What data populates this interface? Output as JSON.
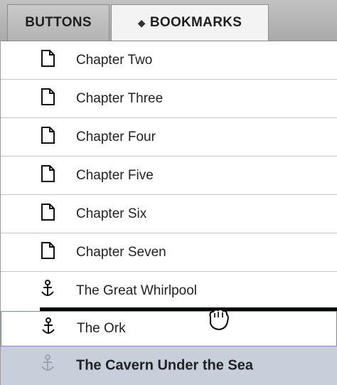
{
  "tabs": [
    {
      "label": "BUTTONS",
      "active": false
    },
    {
      "label": "BOOKMARKS",
      "active": true,
      "sort_glyph": "♢"
    }
  ],
  "bookmarks": [
    {
      "label": "Chapter Two",
      "icon": "page-icon"
    },
    {
      "label": "Chapter Three",
      "icon": "page-icon"
    },
    {
      "label": "Chapter Four",
      "icon": "page-icon"
    },
    {
      "label": "Chapter Five",
      "icon": "page-icon"
    },
    {
      "label": "Chapter Six",
      "icon": "page-icon"
    },
    {
      "label": "Chapter Seven",
      "icon": "page-icon"
    },
    {
      "label": "The Great Whirlpool",
      "icon": "anchor-icon"
    },
    {
      "label": "The Ork",
      "icon": "anchor-icon",
      "state": "drop-target"
    },
    {
      "label": "The Cavern Under the Sea",
      "icon": "anchor-icon",
      "state": "selected"
    }
  ],
  "colors": {
    "selected_row": "#c7cfdb",
    "insert_line": "#000000",
    "hover_border": "#7f93c8"
  },
  "cursor": "grab-hand-icon"
}
